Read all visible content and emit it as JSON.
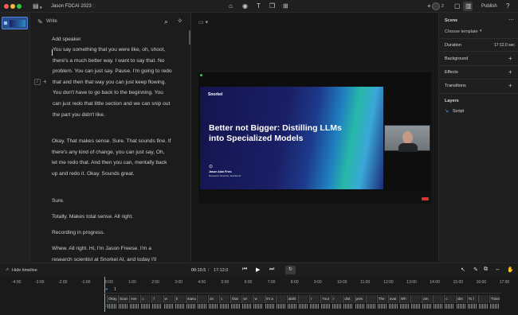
{
  "window": {
    "title": "Jason FDCAI 2023"
  },
  "topbar": {
    "publish_label": "Publish",
    "collab_count": "2"
  },
  "script": {
    "mode_label": "Write",
    "add_speaker": "Add speaker",
    "paragraphs": [
      "You say something that you were like, oh, shoot, there's a much better way. I want to say that. No problem. You can just say. Pause. I'm going to redo that and then that way you can just keep flowing. You don't have to go back to the beginning. You can just redo that little section and we can snip out the part you didn't like.",
      "Okay. That makes sense. Sure. That sounds fine. If there's any kind of change, you can just say, Oh, let me redo that. And then you can, mentally back up and redo it. Okay. Sounds great.",
      "Sure.",
      "Totally. Makes total sense. All right.",
      "Recording in progress.",
      "Whew. All right. Hi, I'm Jason Freese. I'm a research scientist at Snorkel AI, and today I'll"
    ]
  },
  "slide": {
    "brand": "Snorkel",
    "title": "Better not Bigger: Distilling LLMs into Specialized Models",
    "speaker_name": "Jason Alan Fries",
    "speaker_role": "Research Scientist, Snorkel AI"
  },
  "props": {
    "scene_label": "Scene",
    "choose_template": "Choose template",
    "duration_label": "Duration",
    "duration_value": "17:12.0 sec",
    "background_label": "Background",
    "effects_label": "Effects",
    "transitions_label": "Transitions",
    "layers_label": "Layers",
    "layer_script": "Script"
  },
  "timeline": {
    "hide_label": "Hide timeline",
    "time_current": "00:10.5",
    "time_total": "17:12.0",
    "track_number": "1",
    "ruler_negative": [
      "-4:00",
      "-3:00",
      "-2:00",
      "-1:00"
    ],
    "ruler": [
      "0:00",
      "1:00",
      "2:00",
      "3:00",
      "4:00",
      "5:00",
      "6:00",
      "7:00",
      "8:00",
      "9:00",
      "10:00",
      "11:00",
      "12:00",
      "13:00",
      "14:00",
      "15:00",
      "16:00",
      "17:00"
    ],
    "clips": [
      "Okay.",
      "Soun",
      "eve",
      "c",
      "f",
      "w",
      "ti",
      "manual",
      "",
      "on",
      "c",
      "that",
      "wr",
      "w",
      "it's a",
      "",
      "abilit",
      "",
      "r",
      "Your",
      "r",
      "dist",
      "pres",
      "",
      "The",
      "avai",
      "Wh",
      "",
      "am",
      "",
      "c",
      "obs",
      "To f",
      "",
      "Trainin"
    ]
  }
}
